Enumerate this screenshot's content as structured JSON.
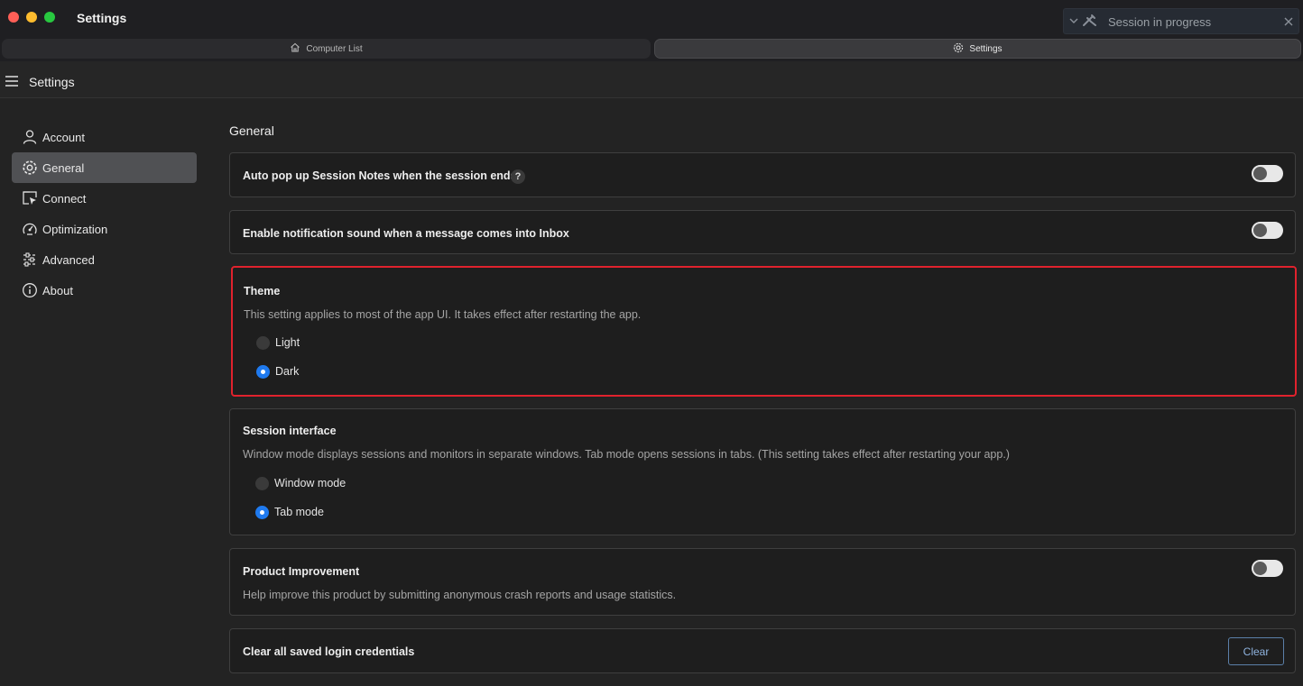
{
  "window": {
    "title": "Settings",
    "session_banner": {
      "text": "Session in progress"
    }
  },
  "tabs": [
    {
      "label": "Computer List",
      "icon": "home-icon"
    },
    {
      "label": "Settings",
      "icon": "gear-icon"
    }
  ],
  "header": {
    "title": "Settings"
  },
  "sidebar": {
    "items": [
      {
        "label": "Account",
        "icon": "user-icon"
      },
      {
        "label": "General",
        "icon": "gear-icon",
        "active": true
      },
      {
        "label": "Connect",
        "icon": "cursor-window-icon"
      },
      {
        "label": "Optimization",
        "icon": "gauge-icon"
      },
      {
        "label": "Advanced",
        "icon": "sliders-icon"
      },
      {
        "label": "About",
        "icon": "info-icon"
      }
    ]
  },
  "main": {
    "section_title": "General",
    "auto_popup": {
      "label": "Auto pop up Session Notes when the session ends",
      "help": "?",
      "enabled": false
    },
    "notification_sound": {
      "label": "Enable notification sound when a message comes into Inbox",
      "enabled": false
    },
    "theme": {
      "title": "Theme",
      "description": "This setting applies to most of the app UI. It takes effect after restarting the app.",
      "options": [
        "Light",
        "Dark"
      ],
      "selected": "Dark"
    },
    "session_interface": {
      "title": "Session interface",
      "description": "Window mode displays sessions and monitors in separate windows. Tab mode opens sessions in tabs. (This setting takes effect after restarting your app.)",
      "options": [
        "Window mode",
        "Tab mode"
      ],
      "selected": "Tab mode"
    },
    "product_improvement": {
      "title": "Product Improvement",
      "description": "Help improve this product by submitting anonymous crash reports and usage statistics.",
      "enabled": false
    },
    "clear_credentials": {
      "label": "Clear all saved login credentials",
      "button": "Clear"
    }
  },
  "colors": {
    "accent": "#1f7aef",
    "highlight_border": "#e0222d"
  }
}
